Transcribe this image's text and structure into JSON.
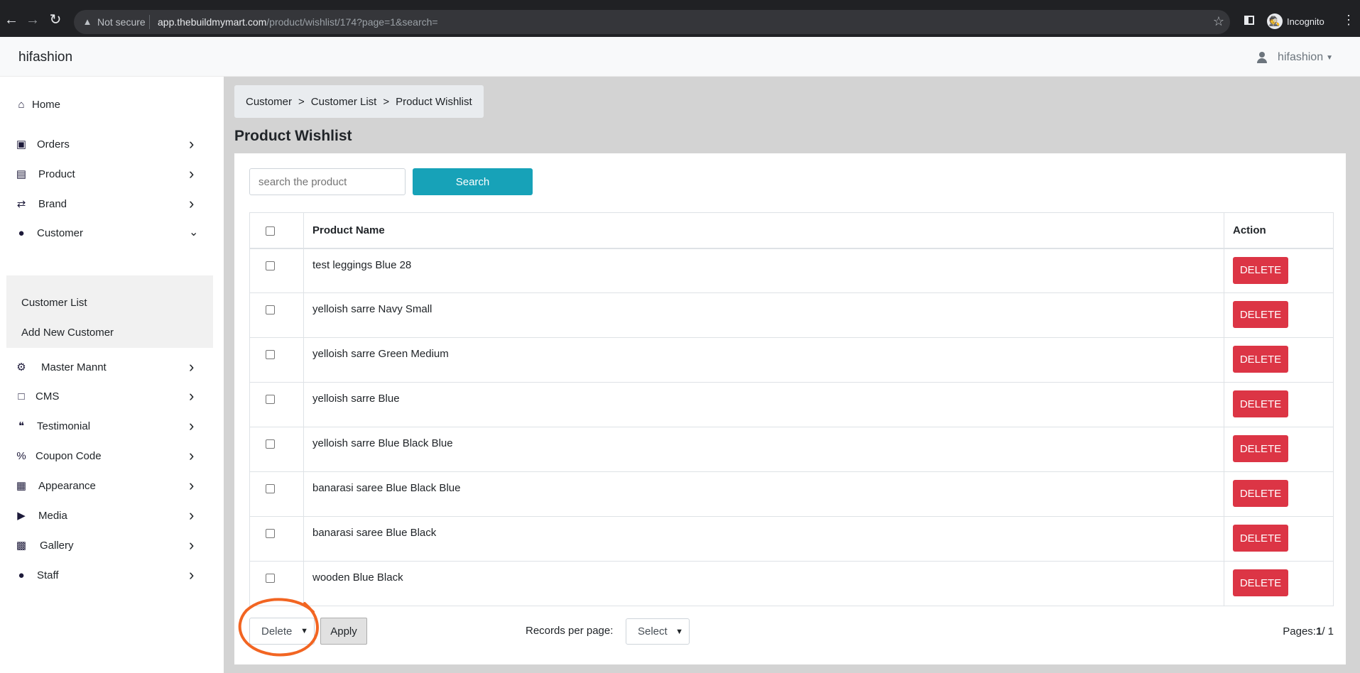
{
  "browser": {
    "security_label": "Not secure",
    "url_host": "app.thebuildmymart.com",
    "url_path": "/product/wishlist/174?page=1&search=",
    "profile_label": "Incognito"
  },
  "header": {
    "brand": "hifashion",
    "user_name": "hifashion"
  },
  "sidebar": {
    "items": [
      {
        "label": "Home",
        "icon": "home-icon"
      },
      {
        "label": "Orders",
        "icon": "shopping-bag-icon"
      },
      {
        "label": "Product",
        "icon": "archive-box-icon"
      },
      {
        "label": "Brand",
        "icon": "shuffle-icon"
      },
      {
        "label": "Customer",
        "icon": "user-icon"
      },
      {
        "label": "Master Mannt",
        "icon": "user-gear-icon"
      },
      {
        "label": "CMS",
        "icon": "document-icon"
      },
      {
        "label": "Testimonial",
        "icon": "quote-icon"
      },
      {
        "label": "Coupon Code",
        "icon": "percent-icon"
      },
      {
        "label": "Appearance",
        "icon": "image-icon"
      },
      {
        "label": "Media",
        "icon": "play-circle-icon"
      },
      {
        "label": "Gallery",
        "icon": "images-icon"
      },
      {
        "label": "Staff",
        "icon": "user-icon"
      }
    ],
    "customer_submenu": [
      "Customer List",
      "Add New Customer"
    ]
  },
  "breadcrumb": [
    "Customer",
    "Customer List",
    "Product Wishlist"
  ],
  "breadcrumb_separator": ">",
  "page_title": "Product Wishlist",
  "search": {
    "placeholder": "search the product",
    "value": "",
    "button_label": "Search"
  },
  "table": {
    "headers": {
      "name": "Product Name",
      "action": "Action"
    },
    "action_label": "DELETE",
    "rows": [
      "test leggings Blue 28",
      "yelloish sarre Navy Small",
      "yelloish sarre Green Medium",
      "yelloish sarre Blue",
      "yelloish sarre Blue Black Blue",
      "banarasi saree Blue Black Blue",
      "banarasi saree Blue Black",
      "wooden Blue Black"
    ]
  },
  "footer": {
    "bulk_action_value": "Delete",
    "apply_label": "Apply",
    "records_label": "Records per page:",
    "records_value": "Select",
    "pages_label": "Pages:",
    "current_page": "1",
    "total_pages": "/ 1"
  },
  "colors": {
    "primary_dark": "#1d1a3a",
    "search_button": "#17a2b8",
    "delete_button": "#dc3545",
    "annotation": "#f26522"
  }
}
